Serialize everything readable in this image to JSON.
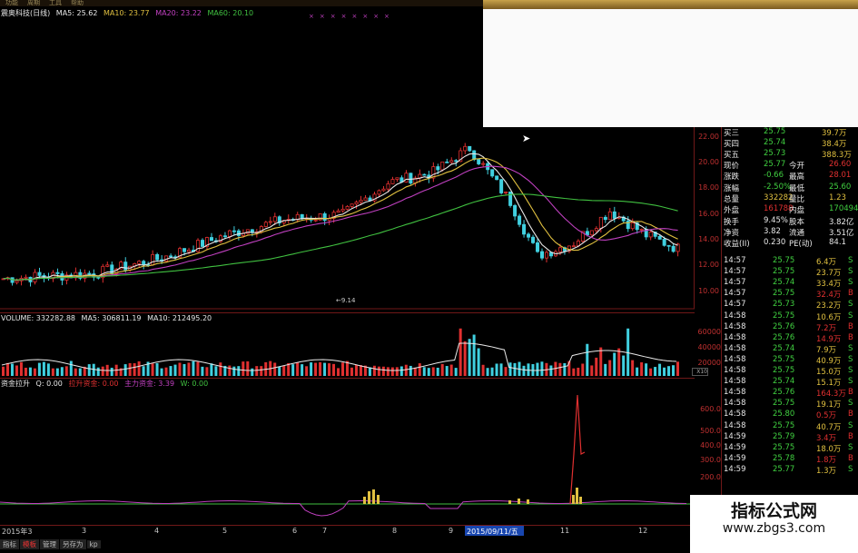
{
  "stock_header": {
    "title": "震奥科技(日线)",
    "ma5": "MA5: 25.62",
    "ma10": "MA10: 23.77",
    "ma20": "MA20: 23.22",
    "ma60": "MA60: 20.10"
  },
  "menu": [
    "功能",
    "周期",
    "工具",
    "帮助"
  ],
  "price_axis": [
    "22.00",
    "20.00",
    "18.00",
    "16.00",
    "14.00",
    "12.00",
    "10.00"
  ],
  "annotation_low": "9.14",
  "volume_header": {
    "volume": "VOLUME: 332282.88",
    "ma5": "MA5: 306811.19",
    "ma10": "MA10: 212495.20"
  },
  "volume_axis": [
    "60000",
    "40000",
    "20000",
    "X10"
  ],
  "fund_header": {
    "name": "资金拉升",
    "q": "Q: 0.00",
    "pull": "拉升资金: 0.00",
    "main": "主力资金: 3.39",
    "w": "W: 0.00"
  },
  "fund_axis": [
    "600.0",
    "500.0",
    "400.0",
    "300.0",
    "200.0"
  ],
  "order_book": [
    {
      "label": "买三",
      "price": "25.75",
      "vol": "39.7万"
    },
    {
      "label": "买四",
      "price": "25.74",
      "vol": "38.4万"
    },
    {
      "label": "买五",
      "price": "25.73",
      "vol": "388.3万"
    }
  ],
  "quote": [
    {
      "l1": "现价",
      "v1": "25.77",
      "l2": "今开",
      "v2": "26.60"
    },
    {
      "l1": "涨跌",
      "v1": "-0.66",
      "l2": "最高",
      "v2": "28.01"
    },
    {
      "l1": "涨幅",
      "v1": "-2.50%",
      "l2": "最低",
      "v2": "25.60"
    },
    {
      "l1": "总量",
      "v1": "332282",
      "l2": "量比",
      "v2": "1.23"
    },
    {
      "l1": "外盘",
      "v1": "161788",
      "l2": "内盘",
      "v2": "170494"
    },
    {
      "l1": "换手",
      "v1": "9.45%",
      "l2": "股本",
      "v2": "3.82亿"
    },
    {
      "l1": "净资",
      "v1": "3.82",
      "l2": "流通",
      "v2": "3.51亿"
    },
    {
      "l1": "收益(II)",
      "v1": "0.230",
      "l2": "PE(动)",
      "v2": "84.1"
    }
  ],
  "ticks": [
    {
      "t": "14:57",
      "p": "25.75",
      "v": "6.4万",
      "s": "S"
    },
    {
      "t": "14:57",
      "p": "25.75",
      "v": "23.7万",
      "s": "S"
    },
    {
      "t": "14:57",
      "p": "25.74",
      "v": "33.4万",
      "s": "S"
    },
    {
      "t": "14:57",
      "p": "25.75",
      "v": "32.4万",
      "s": "B"
    },
    {
      "t": "14:57",
      "p": "25.73",
      "v": "23.2万",
      "s": "S"
    },
    {
      "t": "14:58",
      "p": "25.75",
      "v": "10.6万",
      "s": "S"
    },
    {
      "t": "14:58",
      "p": "25.76",
      "v": "7.2万",
      "s": "B"
    },
    {
      "t": "14:58",
      "p": "25.76",
      "v": "14.9万",
      "s": "B"
    },
    {
      "t": "14:58",
      "p": "25.74",
      "v": "7.9万",
      "s": "S"
    },
    {
      "t": "14:58",
      "p": "25.75",
      "v": "40.9万",
      "s": "S"
    },
    {
      "t": "14:58",
      "p": "25.75",
      "v": "15.0万",
      "s": "S"
    },
    {
      "t": "14:58",
      "p": "25.74",
      "v": "15.1万",
      "s": "S"
    },
    {
      "t": "14:58",
      "p": "25.76",
      "v": "164.3万",
      "s": "B"
    },
    {
      "t": "14:58",
      "p": "25.75",
      "v": "19.1万",
      "s": "S"
    },
    {
      "t": "14:58",
      "p": "25.80",
      "v": "0.5万",
      "s": "B"
    },
    {
      "t": "14:58",
      "p": "25.75",
      "v": "40.7万",
      "s": "S"
    },
    {
      "t": "14:59",
      "p": "25.79",
      "v": "3.4万",
      "s": "B"
    },
    {
      "t": "14:59",
      "p": "25.75",
      "v": "18.0万",
      "s": "S"
    },
    {
      "t": "14:59",
      "p": "25.78",
      "v": "1.8万",
      "s": "B"
    },
    {
      "t": "14:59",
      "p": "25.77",
      "v": "1.3万",
      "s": "S"
    }
  ],
  "date_axis": [
    "2015年3",
    "3",
    "4",
    "5",
    "6",
    "7",
    "8",
    "9",
    "11",
    "12"
  ],
  "date_selected": "2015/09/11/五",
  "bottom_tabs": [
    "指标",
    "模板",
    "管理",
    "另存为",
    "kp"
  ],
  "watermark": {
    "cn": "指标公式网",
    "url": "www.zbgs3.com"
  },
  "colors": {
    "up": "#e03030",
    "down": "#40d0e0",
    "ma5": "#e8e8e8",
    "ma10": "#e0c040",
    "ma20": "#c040c0",
    "ma60": "#40c040",
    "grid": "#701818"
  }
}
